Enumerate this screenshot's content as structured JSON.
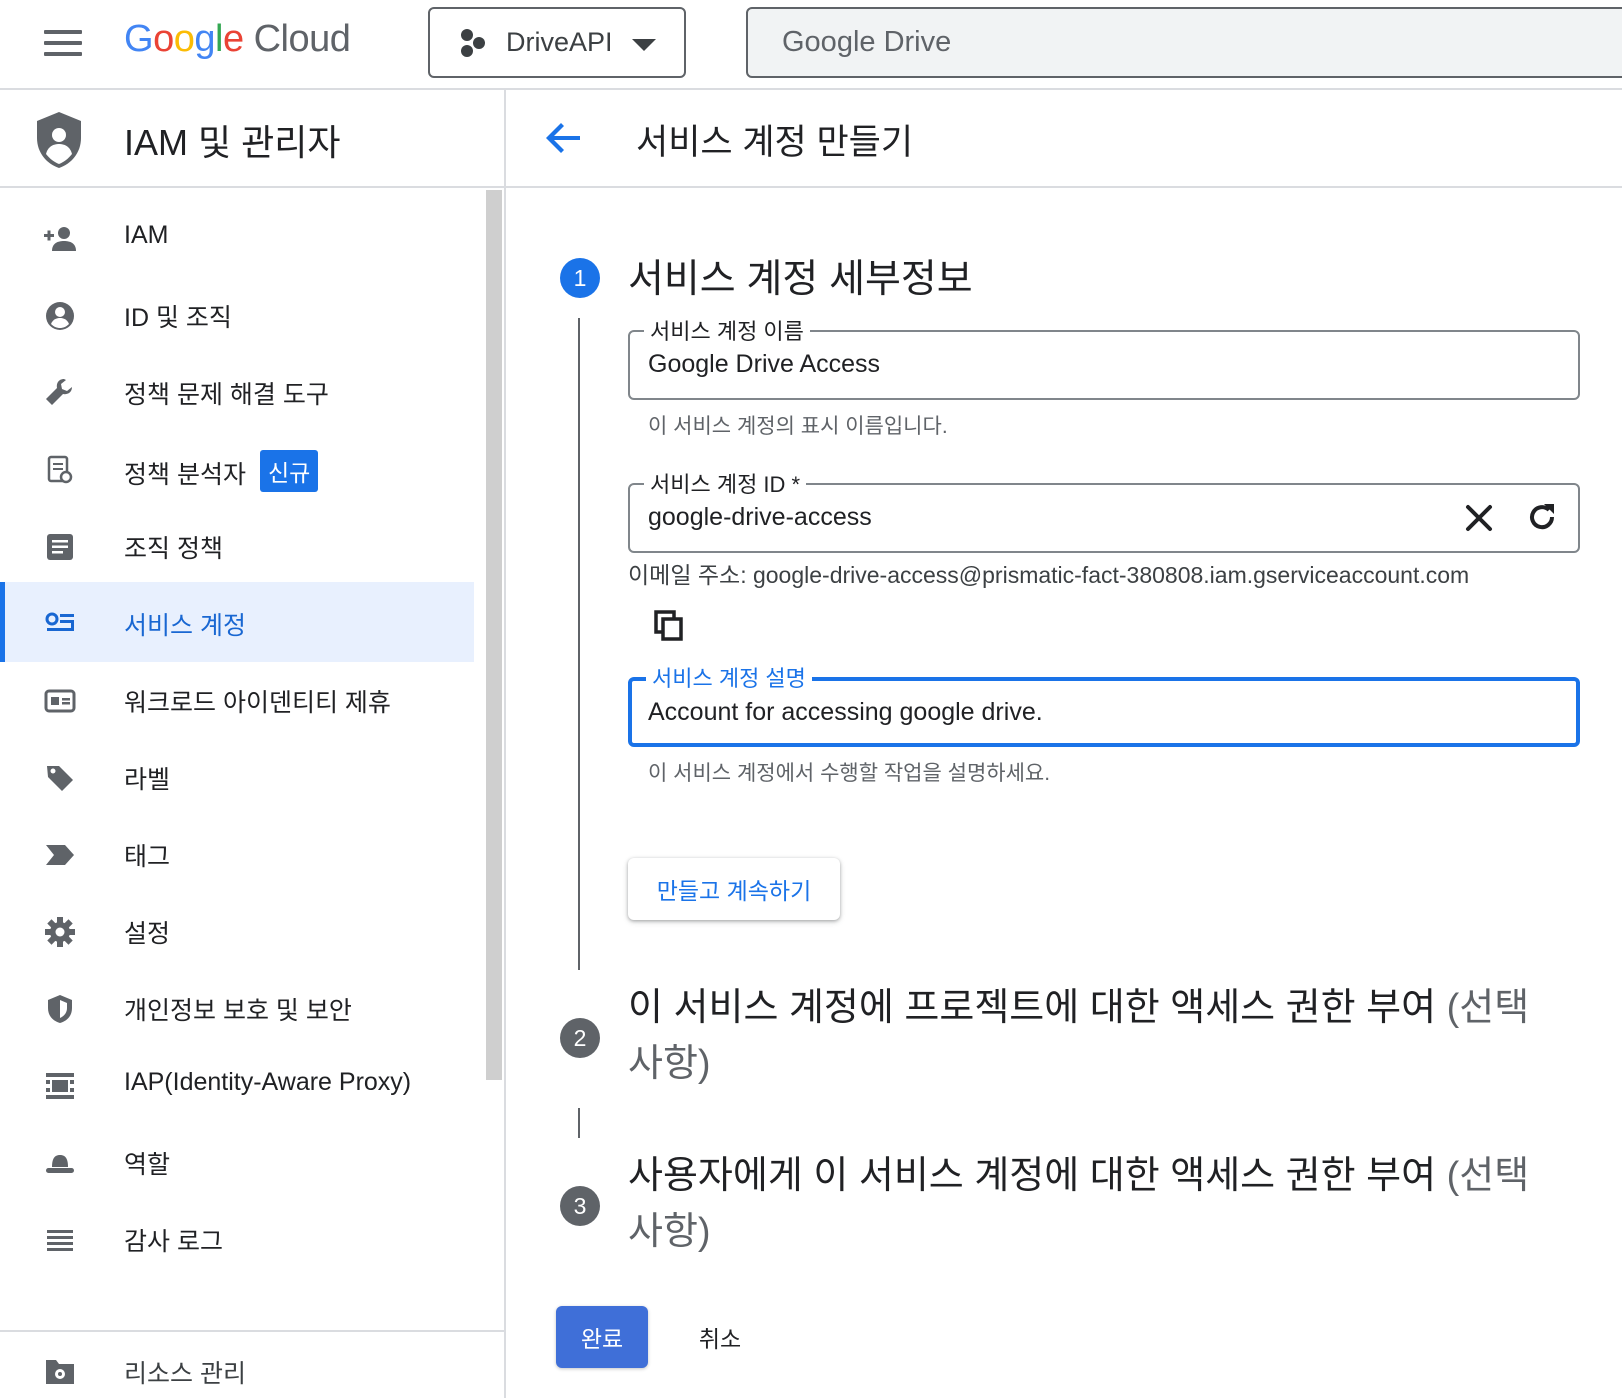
{
  "topbar": {
    "logo": {
      "g1": "G",
      "g2": "o",
      "g3": "o",
      "g4": "g",
      "g5": "l",
      "g6": "e",
      "cloud": "Cloud"
    },
    "project": "DriveAPI",
    "search_value": "Google Drive"
  },
  "sidenav": {
    "title": "IAM 및 관리자",
    "items": [
      {
        "label": "IAM",
        "icon": "person-add-icon"
      },
      {
        "label": "ID 및 조직",
        "icon": "account-circle-icon"
      },
      {
        "label": "정책 문제 해결 도구",
        "icon": "wrench-icon"
      },
      {
        "label": "정책 분석자",
        "icon": "policy-document-icon",
        "badge": "신규"
      },
      {
        "label": "조직 정책",
        "icon": "article-icon"
      },
      {
        "label": "서비스 계정",
        "icon": "service-account-icon",
        "active": true
      },
      {
        "label": "워크로드 아이덴티티 제휴",
        "icon": "id-card-icon"
      },
      {
        "label": "라벨",
        "icon": "label-tag-icon"
      },
      {
        "label": "태그",
        "icon": "tag-arrow-icon"
      },
      {
        "label": "설정",
        "icon": "gear-icon"
      },
      {
        "label": "개인정보 보호 및 보안",
        "icon": "security-shield-icon"
      },
      {
        "label": "IAP(Identity-Aware Proxy)",
        "icon": "proxy-icon"
      },
      {
        "label": "역할",
        "icon": "roles-hat-icon"
      },
      {
        "label": "감사 로그",
        "icon": "list-lines-icon"
      }
    ],
    "bottom_item": "리소스 관리"
  },
  "main": {
    "page_title": "서비스 계정 만들기",
    "steps": [
      {
        "number": "1",
        "title": "서비스 계정 세부정보"
      },
      {
        "number": "2",
        "title": "이 서비스 계정에 프로젝트에 대한 액세스 권한 부여 ",
        "optional": "(선택사항)"
      },
      {
        "number": "3",
        "title": "사용자에게 이 서비스 계정에 대한 액세스 권한 부여 ",
        "optional": "(선택사항)"
      }
    ],
    "fields": {
      "name": {
        "label": "서비스 계정 이름",
        "value": "Google Drive Access",
        "helper": "이 서비스 계정의 표시 이름입니다."
      },
      "id": {
        "label": "서비스 계정 ID *",
        "value": "google-drive-access"
      },
      "email": "이메일 주소: google-drive-access@prismatic-fact-380808.iam.gserviceaccount.com",
      "description": {
        "label": "서비스 계정 설명",
        "value": "Account for accessing google drive.",
        "helper": "이 서비스 계정에서 수행할 작업을 설명하세요."
      }
    },
    "continue_label": "만들고 계속하기",
    "done_label": "완료",
    "cancel_label": "취소"
  },
  "colors": {
    "accent": "#1a73e8",
    "active_bg": "#e8f0fe",
    "done_button": "#3f6fd8",
    "step_inactive": "#5f6368"
  }
}
